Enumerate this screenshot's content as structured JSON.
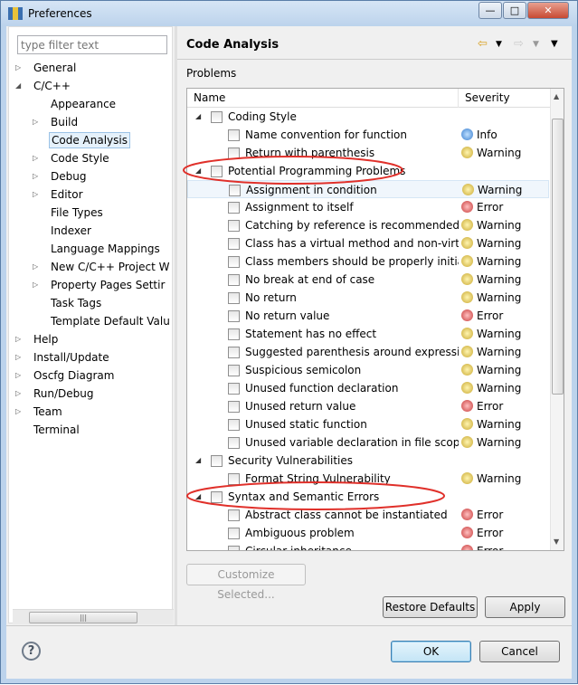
{
  "window": {
    "title": "Preferences"
  },
  "filter": {
    "placeholder": "type filter text"
  },
  "tree": [
    {
      "label": "General",
      "level": 0,
      "expander": "collapsed"
    },
    {
      "label": "C/C++",
      "level": 0,
      "expander": "expanded"
    },
    {
      "label": "Appearance",
      "level": 1,
      "expander": "none"
    },
    {
      "label": "Build",
      "level": 1,
      "expander": "collapsed"
    },
    {
      "label": "Code Analysis",
      "level": 1,
      "expander": "none",
      "selected": true
    },
    {
      "label": "Code Style",
      "level": 1,
      "expander": "collapsed"
    },
    {
      "label": "Debug",
      "level": 1,
      "expander": "collapsed"
    },
    {
      "label": "Editor",
      "level": 1,
      "expander": "collapsed"
    },
    {
      "label": "File Types",
      "level": 1,
      "expander": "none"
    },
    {
      "label": "Indexer",
      "level": 1,
      "expander": "none"
    },
    {
      "label": "Language Mappings",
      "level": 1,
      "expander": "none"
    },
    {
      "label": "New C/C++ Project W",
      "level": 1,
      "expander": "collapsed"
    },
    {
      "label": "Property Pages Settir",
      "level": 1,
      "expander": "collapsed"
    },
    {
      "label": "Task Tags",
      "level": 1,
      "expander": "none"
    },
    {
      "label": "Template Default Valu",
      "level": 1,
      "expander": "none"
    },
    {
      "label": "Help",
      "level": 0,
      "expander": "collapsed"
    },
    {
      "label": "Install/Update",
      "level": 0,
      "expander": "collapsed"
    },
    {
      "label": "Oscfg Diagram",
      "level": 0,
      "expander": "collapsed"
    },
    {
      "label": "Run/Debug",
      "level": 0,
      "expander": "collapsed"
    },
    {
      "label": "Team",
      "level": 0,
      "expander": "collapsed"
    },
    {
      "label": "Terminal",
      "level": 0,
      "expander": "none"
    }
  ],
  "page": {
    "title": "Code Analysis",
    "section": "Problems",
    "col_name": "Name",
    "col_severity": "Severity"
  },
  "problems": [
    {
      "name": "Coding Style",
      "category": true
    },
    {
      "name": "Name convention for function",
      "severity": "Info"
    },
    {
      "name": "Return with parenthesis",
      "severity": "Warning"
    },
    {
      "name": "Potential Programming Problems",
      "category": true,
      "circled": true
    },
    {
      "name": "Assignment in condition",
      "severity": "Warning",
      "hover": true
    },
    {
      "name": "Assignment to itself",
      "severity": "Error"
    },
    {
      "name": "Catching by reference is recommended",
      "severity": "Warning"
    },
    {
      "name": "Class has a virtual method and non-virtual destructor",
      "severity": "Warning"
    },
    {
      "name": "Class members should be properly initialized",
      "severity": "Warning"
    },
    {
      "name": "No break at end of case",
      "severity": "Warning"
    },
    {
      "name": "No return",
      "severity": "Warning"
    },
    {
      "name": "No return value",
      "severity": "Error"
    },
    {
      "name": "Statement has no effect",
      "severity": "Warning"
    },
    {
      "name": "Suggested parenthesis around expression",
      "severity": "Warning"
    },
    {
      "name": "Suspicious semicolon",
      "severity": "Warning"
    },
    {
      "name": "Unused function declaration",
      "severity": "Warning"
    },
    {
      "name": "Unused return value",
      "severity": "Error"
    },
    {
      "name": "Unused static function",
      "severity": "Warning"
    },
    {
      "name": "Unused variable declaration in file scope",
      "severity": "Warning"
    },
    {
      "name": "Security Vulnerabilities",
      "category": true
    },
    {
      "name": "Format String Vulnerability",
      "severity": "Warning"
    },
    {
      "name": "Syntax and Semantic Errors",
      "category": true,
      "circled": true
    },
    {
      "name": "Abstract class cannot be instantiated",
      "severity": "Error"
    },
    {
      "name": "Ambiguous problem",
      "severity": "Error"
    },
    {
      "name": "Circular inheritance",
      "severity": "Error"
    }
  ],
  "buttons": {
    "customize": "Customize Selected...",
    "restore": "Restore Defaults",
    "apply": "Apply",
    "ok": "OK",
    "cancel": "Cancel",
    "help": "?"
  },
  "annotation_color": "#e0302a"
}
